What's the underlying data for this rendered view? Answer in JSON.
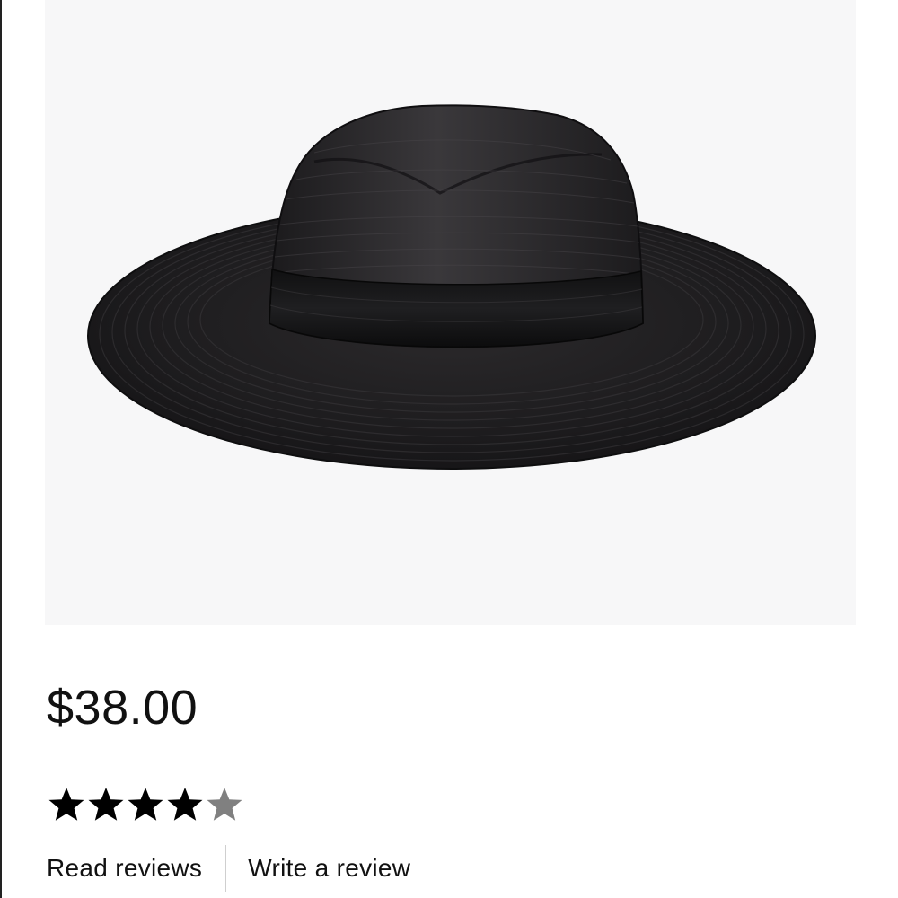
{
  "product": {
    "image_alt": "Black straw panama hat",
    "price": "$38.00"
  },
  "rating": {
    "value": 4,
    "max": 5,
    "icon": "star-icon",
    "filled_color": "#000000",
    "empty_color": "#808080"
  },
  "reviews": {
    "read_label": "Read reviews",
    "write_label": "Write a review"
  }
}
